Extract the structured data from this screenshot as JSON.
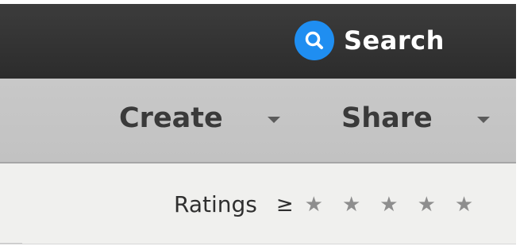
{
  "topbar": {
    "search_label": "Search",
    "search_icon": "search-icon"
  },
  "toolbar": {
    "create_label": "Create",
    "share_label": "Share"
  },
  "filter": {
    "ratings_label": "Ratings",
    "comparator": "≥",
    "stars": [
      "★",
      "★",
      "★",
      "★",
      "★"
    ],
    "selected_rating": 0
  },
  "colors": {
    "accent": "#1f8ef1",
    "topbar_bg": "#333333",
    "toolbar_bg": "#c5c5c5",
    "filter_bg": "#f0f0ee"
  }
}
